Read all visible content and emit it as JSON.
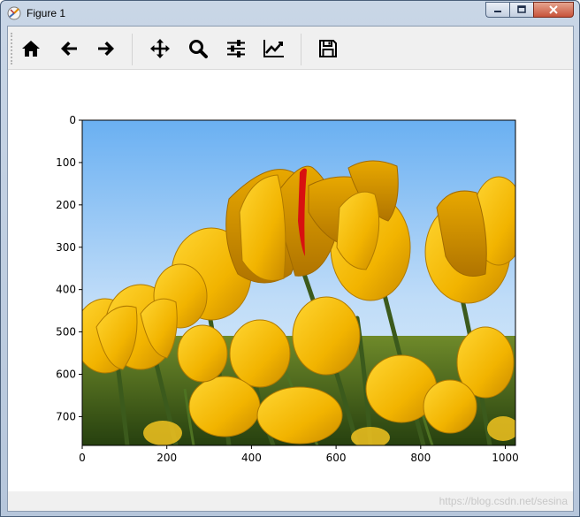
{
  "window": {
    "title": "Figure 1",
    "buttons": {
      "minimize": "–",
      "maximize": "□",
      "close": "X"
    }
  },
  "toolbar": {
    "buttons": [
      {
        "name": "home",
        "icon": "home-icon",
        "tooltip": "Reset original view"
      },
      {
        "name": "back",
        "icon": "arrow-left-icon",
        "tooltip": "Back to previous view"
      },
      {
        "name": "forward",
        "icon": "arrow-right-icon",
        "tooltip": "Forward to next view"
      },
      {
        "name": "pan",
        "icon": "move-arrows-icon",
        "tooltip": "Pan axes"
      },
      {
        "name": "zoom",
        "icon": "magnifier-icon",
        "tooltip": "Zoom to rectangle"
      },
      {
        "name": "subplots",
        "icon": "sliders-icon",
        "tooltip": "Configure subplots"
      },
      {
        "name": "customize",
        "icon": "line-chart-icon",
        "tooltip": "Edit axis, curve and image parameters"
      },
      {
        "name": "save",
        "icon": "floppy-disk-icon",
        "tooltip": "Save the figure"
      }
    ]
  },
  "figure": {
    "x_ticks": [
      "0",
      "200",
      "400",
      "600",
      "800",
      "1000"
    ],
    "y_ticks": [
      "0",
      "100",
      "200",
      "300",
      "400",
      "500",
      "600",
      "700"
    ],
    "image_content": "yellow tulips against blue sky with one red-streaked petal"
  },
  "chart_data": {
    "type": "image",
    "xlim": [
      0,
      1024
    ],
    "ylim": [
      768,
      0
    ],
    "x_tick_values": [
      0,
      200,
      400,
      600,
      800,
      1000
    ],
    "y_tick_values": [
      0,
      100,
      200,
      300,
      400,
      500,
      600,
      700
    ],
    "title": "",
    "xlabel": "",
    "ylabel": ""
  },
  "status": {
    "watermark": "https://blog.csdn.net/sesina"
  },
  "colors": {
    "sky_top": "#6ab0f2",
    "sky_bottom": "#cfe6fb",
    "tulip": "#f2b400",
    "tulip_shadow": "#c98a00",
    "stem": "#3b5a1c",
    "red_streak": "#d81010"
  }
}
